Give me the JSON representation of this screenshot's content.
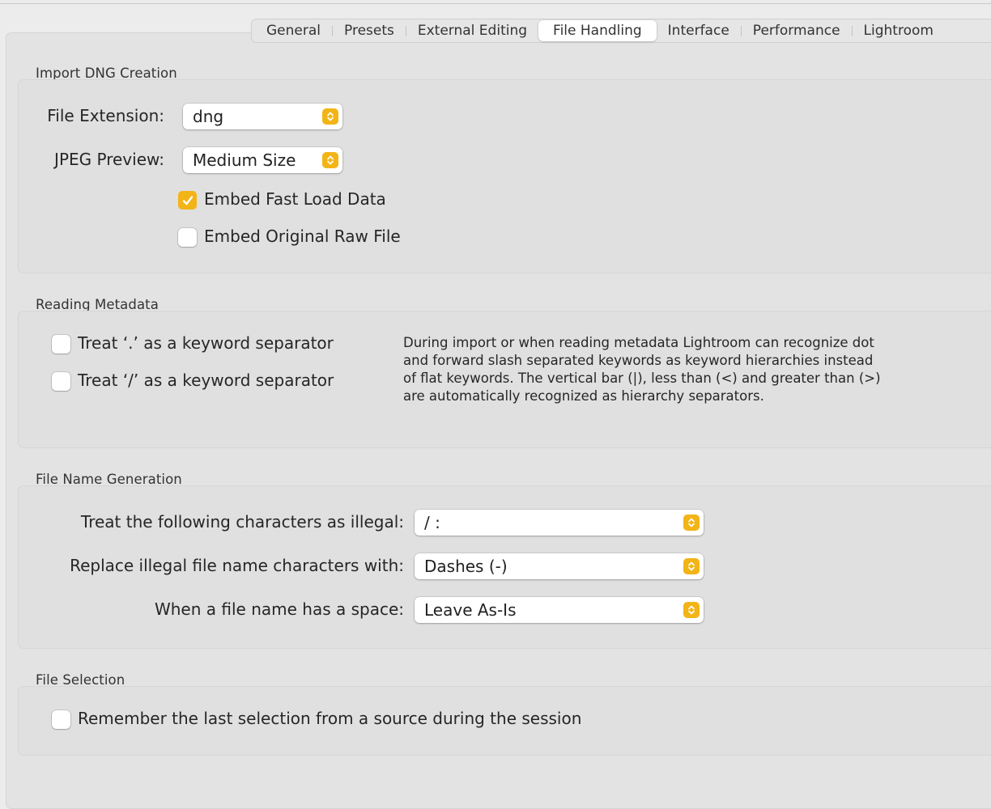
{
  "tabs": [
    "General",
    "Presets",
    "External Editing",
    "File Handling",
    "Interface",
    "Performance",
    "Lightroom"
  ],
  "selected_tab": "File Handling",
  "import_dng": {
    "title": "Import DNG Creation",
    "file_extension_label": "File Extension:",
    "file_extension_value": "dng",
    "jpeg_preview_label": "JPEG Preview:",
    "jpeg_preview_value": "Medium Size",
    "embed_fast_load_label": "Embed Fast Load Data",
    "embed_fast_load_checked": true,
    "embed_original_raw_label": "Embed Original Raw File",
    "embed_original_raw_checked": false
  },
  "reading_metadata": {
    "title": "Reading Metadata",
    "dot_separator_label": "Treat ‘.’ as a keyword separator",
    "dot_separator_checked": false,
    "slash_separator_label": "Treat ‘/’ as a keyword separator",
    "slash_separator_checked": false,
    "description": "During import or when reading metadata Lightroom can recognize dot and forward slash separated keywords as keyword hierarchies instead of flat keywords. The vertical bar (|), less than (<) and greater than (>) are automatically recognized as hierarchy separators."
  },
  "file_name_generation": {
    "title": "File Name Generation",
    "illegal_chars_label": "Treat the following characters as illegal:",
    "illegal_chars_value": "/ :",
    "replace_label": "Replace illegal file name characters with:",
    "replace_value": "Dashes (-)",
    "space_label": "When a file name has a space:",
    "space_value": "Leave As-Is"
  },
  "file_selection": {
    "title": "File Selection",
    "remember_label": "Remember the last selection from a source during the session",
    "remember_checked": false
  },
  "colors": {
    "accent": "#f2b416",
    "pane_bg": "#e3e3e3",
    "window_bg": "#ececec"
  }
}
